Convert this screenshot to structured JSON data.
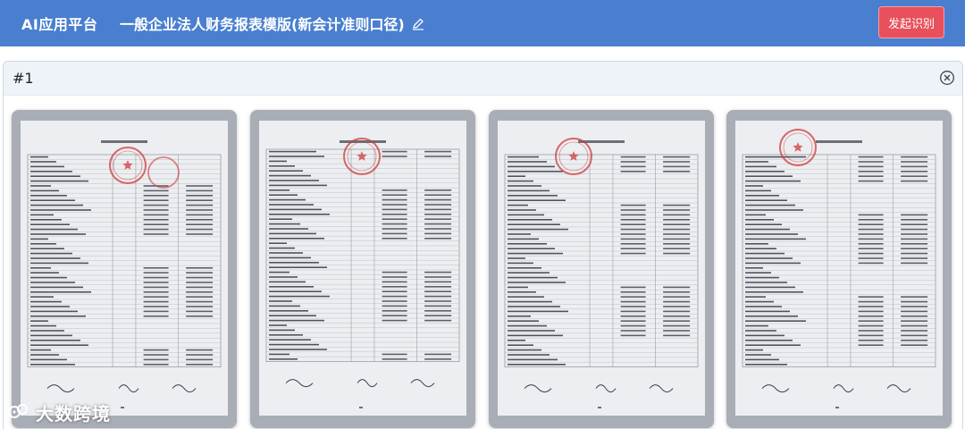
{
  "header": {
    "app_name": "AI应用平台",
    "doc_title": "一般企业法人财务报表模版(新会计准则口径)",
    "action_button": "发起识别"
  },
  "panel": {
    "title": "#1"
  },
  "thumbnails": [
    {
      "kind": "balance-sheet"
    },
    {
      "kind": "balance-sheet-continued"
    },
    {
      "kind": "income-statement"
    },
    {
      "kind": "cash-flow-statement"
    }
  ],
  "watermark": {
    "text": "大数跨境"
  },
  "colors": {
    "header_bg": "#4a7fd0",
    "button_bg": "#e8505b",
    "panel_header_bg": "#eef3f9",
    "thumb_bg": "#a8adb6",
    "stamp_red": "#d03a3a"
  }
}
